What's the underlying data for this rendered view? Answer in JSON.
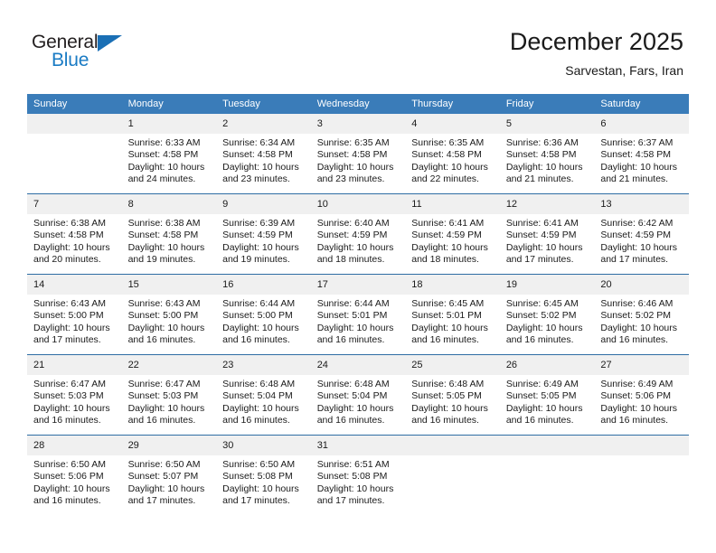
{
  "brand": {
    "name_part1": "General",
    "name_part2": "Blue",
    "accent_color": "#1a7bc4"
  },
  "header": {
    "title": "December 2025",
    "location": "Sarvestan, Fars, Iran"
  },
  "theme": {
    "header_blue": "#3a7cb9",
    "row_rule_blue": "#2e6da4",
    "daynum_band": "#f0f0f0"
  },
  "calendar": {
    "weekday_headers": [
      "Sunday",
      "Monday",
      "Tuesday",
      "Wednesday",
      "Thursday",
      "Friday",
      "Saturday"
    ],
    "weeks": [
      [
        {
          "day": "",
          "lines": []
        },
        {
          "day": "1",
          "lines": [
            "Sunrise: 6:33 AM",
            "Sunset: 4:58 PM",
            "Daylight: 10 hours",
            "and 24 minutes."
          ]
        },
        {
          "day": "2",
          "lines": [
            "Sunrise: 6:34 AM",
            "Sunset: 4:58 PM",
            "Daylight: 10 hours",
            "and 23 minutes."
          ]
        },
        {
          "day": "3",
          "lines": [
            "Sunrise: 6:35 AM",
            "Sunset: 4:58 PM",
            "Daylight: 10 hours",
            "and 23 minutes."
          ]
        },
        {
          "day": "4",
          "lines": [
            "Sunrise: 6:35 AM",
            "Sunset: 4:58 PM",
            "Daylight: 10 hours",
            "and 22 minutes."
          ]
        },
        {
          "day": "5",
          "lines": [
            "Sunrise: 6:36 AM",
            "Sunset: 4:58 PM",
            "Daylight: 10 hours",
            "and 21 minutes."
          ]
        },
        {
          "day": "6",
          "lines": [
            "Sunrise: 6:37 AM",
            "Sunset: 4:58 PM",
            "Daylight: 10 hours",
            "and 21 minutes."
          ]
        }
      ],
      [
        {
          "day": "7",
          "lines": [
            "Sunrise: 6:38 AM",
            "Sunset: 4:58 PM",
            "Daylight: 10 hours",
            "and 20 minutes."
          ]
        },
        {
          "day": "8",
          "lines": [
            "Sunrise: 6:38 AM",
            "Sunset: 4:58 PM",
            "Daylight: 10 hours",
            "and 19 minutes."
          ]
        },
        {
          "day": "9",
          "lines": [
            "Sunrise: 6:39 AM",
            "Sunset: 4:59 PM",
            "Daylight: 10 hours",
            "and 19 minutes."
          ]
        },
        {
          "day": "10",
          "lines": [
            "Sunrise: 6:40 AM",
            "Sunset: 4:59 PM",
            "Daylight: 10 hours",
            "and 18 minutes."
          ]
        },
        {
          "day": "11",
          "lines": [
            "Sunrise: 6:41 AM",
            "Sunset: 4:59 PM",
            "Daylight: 10 hours",
            "and 18 minutes."
          ]
        },
        {
          "day": "12",
          "lines": [
            "Sunrise: 6:41 AM",
            "Sunset: 4:59 PM",
            "Daylight: 10 hours",
            "and 17 minutes."
          ]
        },
        {
          "day": "13",
          "lines": [
            "Sunrise: 6:42 AM",
            "Sunset: 4:59 PM",
            "Daylight: 10 hours",
            "and 17 minutes."
          ]
        }
      ],
      [
        {
          "day": "14",
          "lines": [
            "Sunrise: 6:43 AM",
            "Sunset: 5:00 PM",
            "Daylight: 10 hours",
            "and 17 minutes."
          ]
        },
        {
          "day": "15",
          "lines": [
            "Sunrise: 6:43 AM",
            "Sunset: 5:00 PM",
            "Daylight: 10 hours",
            "and 16 minutes."
          ]
        },
        {
          "day": "16",
          "lines": [
            "Sunrise: 6:44 AM",
            "Sunset: 5:00 PM",
            "Daylight: 10 hours",
            "and 16 minutes."
          ]
        },
        {
          "day": "17",
          "lines": [
            "Sunrise: 6:44 AM",
            "Sunset: 5:01 PM",
            "Daylight: 10 hours",
            "and 16 minutes."
          ]
        },
        {
          "day": "18",
          "lines": [
            "Sunrise: 6:45 AM",
            "Sunset: 5:01 PM",
            "Daylight: 10 hours",
            "and 16 minutes."
          ]
        },
        {
          "day": "19",
          "lines": [
            "Sunrise: 6:45 AM",
            "Sunset: 5:02 PM",
            "Daylight: 10 hours",
            "and 16 minutes."
          ]
        },
        {
          "day": "20",
          "lines": [
            "Sunrise: 6:46 AM",
            "Sunset: 5:02 PM",
            "Daylight: 10 hours",
            "and 16 minutes."
          ]
        }
      ],
      [
        {
          "day": "21",
          "lines": [
            "Sunrise: 6:47 AM",
            "Sunset: 5:03 PM",
            "Daylight: 10 hours",
            "and 16 minutes."
          ]
        },
        {
          "day": "22",
          "lines": [
            "Sunrise: 6:47 AM",
            "Sunset: 5:03 PM",
            "Daylight: 10 hours",
            "and 16 minutes."
          ]
        },
        {
          "day": "23",
          "lines": [
            "Sunrise: 6:48 AM",
            "Sunset: 5:04 PM",
            "Daylight: 10 hours",
            "and 16 minutes."
          ]
        },
        {
          "day": "24",
          "lines": [
            "Sunrise: 6:48 AM",
            "Sunset: 5:04 PM",
            "Daylight: 10 hours",
            "and 16 minutes."
          ]
        },
        {
          "day": "25",
          "lines": [
            "Sunrise: 6:48 AM",
            "Sunset: 5:05 PM",
            "Daylight: 10 hours",
            "and 16 minutes."
          ]
        },
        {
          "day": "26",
          "lines": [
            "Sunrise: 6:49 AM",
            "Sunset: 5:05 PM",
            "Daylight: 10 hours",
            "and 16 minutes."
          ]
        },
        {
          "day": "27",
          "lines": [
            "Sunrise: 6:49 AM",
            "Sunset: 5:06 PM",
            "Daylight: 10 hours",
            "and 16 minutes."
          ]
        }
      ],
      [
        {
          "day": "28",
          "lines": [
            "Sunrise: 6:50 AM",
            "Sunset: 5:06 PM",
            "Daylight: 10 hours",
            "and 16 minutes."
          ]
        },
        {
          "day": "29",
          "lines": [
            "Sunrise: 6:50 AM",
            "Sunset: 5:07 PM",
            "Daylight: 10 hours",
            "and 17 minutes."
          ]
        },
        {
          "day": "30",
          "lines": [
            "Sunrise: 6:50 AM",
            "Sunset: 5:08 PM",
            "Daylight: 10 hours",
            "and 17 minutes."
          ]
        },
        {
          "day": "31",
          "lines": [
            "Sunrise: 6:51 AM",
            "Sunset: 5:08 PM",
            "Daylight: 10 hours",
            "and 17 minutes."
          ]
        },
        {
          "day": "",
          "lines": []
        },
        {
          "day": "",
          "lines": []
        },
        {
          "day": "",
          "lines": []
        }
      ]
    ]
  }
}
